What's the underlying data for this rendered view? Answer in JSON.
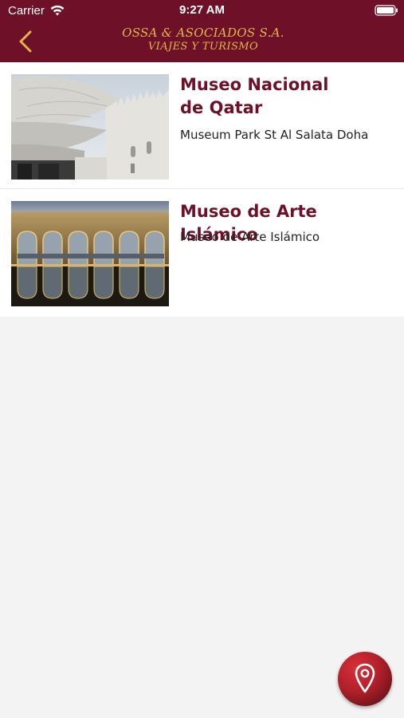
{
  "status_bar": {
    "carrier": "Carrier",
    "time": "9:27 AM"
  },
  "header": {
    "brand_line1": "OSSA & ASOCIADOS S.A.",
    "brand_line2": "VIAJES Y TURISMO",
    "back_icon": "chevron-left-icon"
  },
  "colors": {
    "header_bg": "#6e1128",
    "brand_gold": "#e0b64a",
    "title_maroon": "#6e1128",
    "fab_red": "#c3242e"
  },
  "places": [
    {
      "title_line1": "Museo Nacional",
      "title_line2": "de Qatar",
      "subtitle": "Museum Park St Al Salata Doha"
    },
    {
      "title": "Museo de Arte Islámico",
      "subtitle": "Museo de Arte Islámico"
    }
  ],
  "fab": {
    "icon": "map-pin-icon"
  }
}
